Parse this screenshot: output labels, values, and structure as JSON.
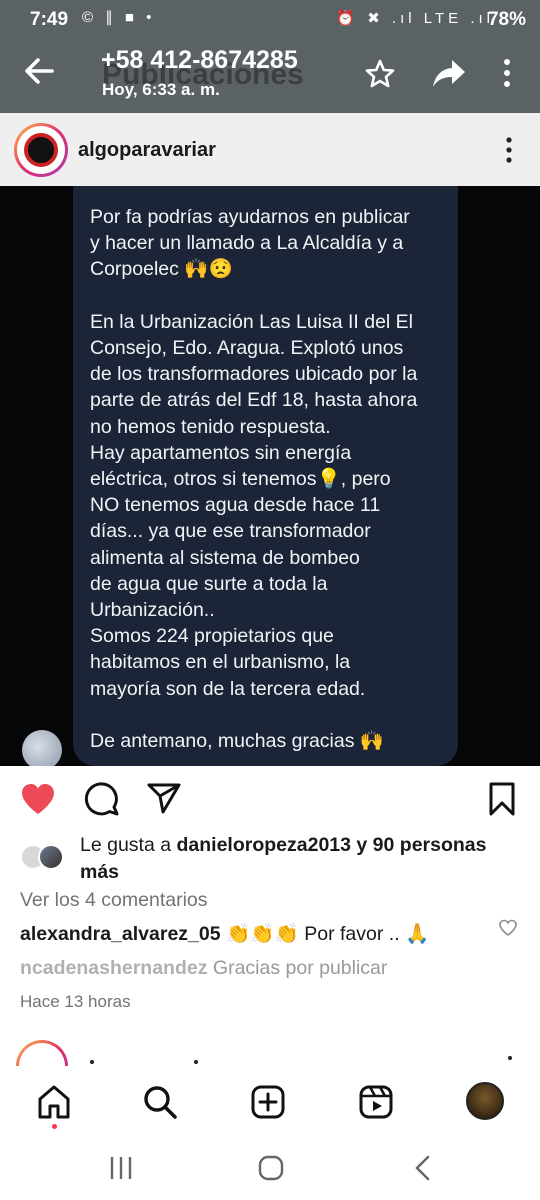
{
  "status_bar": {
    "time": "7:49",
    "left_icons": "© ∥ ■ •",
    "right_icons": "⏰ ✖ .ıl LTE .ıl",
    "battery": "78%"
  },
  "whatsapp_header": {
    "ghost_title": "Publicaciones",
    "contact": "+58 412-8674285",
    "subtitle": "Hoy, 6:33 a. m."
  },
  "post": {
    "username": "algoparavariar",
    "message": "Por fa podrías ayudarnos en publicar\ny hacer un llamado a La Alcaldía y a\nCorpoelec 🙌😟\n\nEn la Urbanización Las Luisa II del El\nConsejo, Edo. Aragua. Explotó unos\nde los transformadores ubicado por la\nparte de atrás del Edf 18, hasta ahora\nno hemos tenido respuesta.\nHay apartamentos sin energía\neléctrica, otros si tenemos💡, pero\nNO tenemos agua desde hace 11\ndías... ya que ese transformador\nalimenta al sistema de bombeo\nde agua que surte a toda la\nUrbanización..\nSomos 224 propietarios que\nhabitamos en el urbanismo, la\nmayoría son de la tercera edad.\n\nDe antemano, muchas gracias 🙌",
    "liked": true
  },
  "likes": {
    "prefix": "Le gusta a ",
    "user": "danieloropeza2013",
    "suffix": " y 90 personas más"
  },
  "comments": {
    "view_all": "Ver los 4 comentarios",
    "items": [
      {
        "user": "alexandra_alvarez_05",
        "text": " 👏👏👏 Por favor .. 🙏"
      },
      {
        "user": "ncadenashernandez",
        "text": " Gracias por publicar"
      }
    ]
  },
  "time_ago": "Hace 13 horas",
  "colors": {
    "like_red": "#ed4956",
    "bubble": "#1c2437",
    "header_grey": "#5b6266"
  },
  "icons": {
    "action_bar": [
      "heart-icon",
      "comment-icon",
      "send-icon",
      "bookmark-icon"
    ],
    "bottom_nav": [
      "home-icon",
      "search-icon",
      "create-icon",
      "reels-icon",
      "profile-avatar"
    ],
    "system_nav": [
      "recents-icon",
      "home-circle-icon",
      "back-chevron-icon"
    ]
  }
}
